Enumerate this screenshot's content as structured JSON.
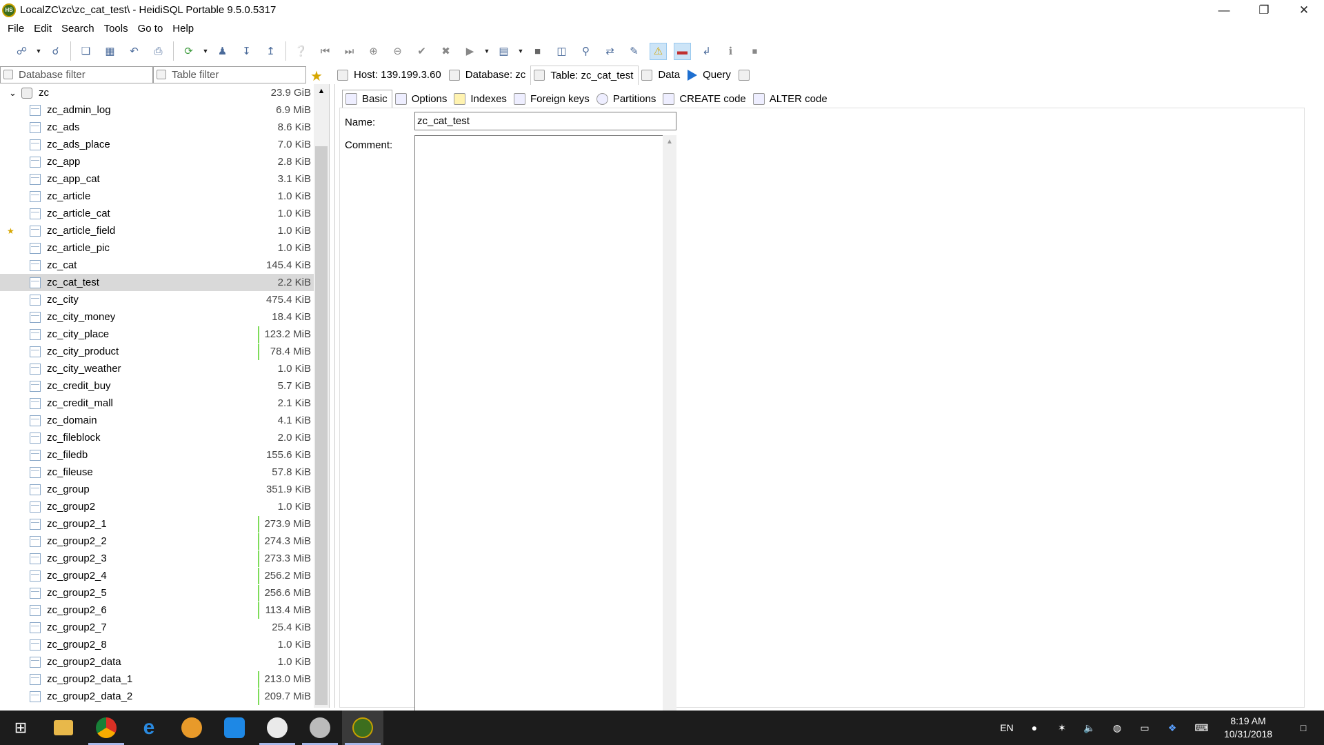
{
  "window": {
    "title": "LocalZC\\zc\\zc_cat_test\\ - HeidiSQL Portable 9.5.0.5317",
    "app_icon_text": "HS"
  },
  "menu": [
    "File",
    "Edit",
    "Search",
    "Tools",
    "Go to",
    "Help"
  ],
  "filters": {
    "database_placeholder": "Database filter",
    "table_placeholder": "Table filter"
  },
  "tree": {
    "database": {
      "name": "zc",
      "size": "23.9 GiB"
    },
    "tables": [
      {
        "name": "zc_admin_log",
        "size": "6.9 MiB"
      },
      {
        "name": "zc_ads",
        "size": "8.6 KiB"
      },
      {
        "name": "zc_ads_place",
        "size": "7.0 KiB"
      },
      {
        "name": "zc_app",
        "size": "2.8 KiB"
      },
      {
        "name": "zc_app_cat",
        "size": "3.1 KiB"
      },
      {
        "name": "zc_article",
        "size": "1.0 KiB"
      },
      {
        "name": "zc_article_cat",
        "size": "1.0 KiB"
      },
      {
        "name": "zc_article_field",
        "size": "1.0 KiB",
        "favorite": true
      },
      {
        "name": "zc_article_pic",
        "size": "1.0 KiB"
      },
      {
        "name": "zc_cat",
        "size": "145.4 KiB"
      },
      {
        "name": "zc_cat_test",
        "size": "2.2 KiB",
        "selected": true
      },
      {
        "name": "zc_city",
        "size": "475.4 KiB"
      },
      {
        "name": "zc_city_money",
        "size": "18.4 KiB"
      },
      {
        "name": "zc_city_place",
        "size": "123.2 MiB",
        "bar": true
      },
      {
        "name": "zc_city_product",
        "size": "78.4 MiB",
        "bar": true
      },
      {
        "name": "zc_city_weather",
        "size": "1.0 KiB"
      },
      {
        "name": "zc_credit_buy",
        "size": "5.7 KiB"
      },
      {
        "name": "zc_credit_mall",
        "size": "2.1 KiB"
      },
      {
        "name": "zc_domain",
        "size": "4.1 KiB"
      },
      {
        "name": "zc_fileblock",
        "size": "2.0 KiB"
      },
      {
        "name": "zc_filedb",
        "size": "155.6 KiB"
      },
      {
        "name": "zc_fileuse",
        "size": "57.8 KiB"
      },
      {
        "name": "zc_group",
        "size": "351.9 KiB"
      },
      {
        "name": "zc_group2",
        "size": "1.0 KiB"
      },
      {
        "name": "zc_group2_1",
        "size": "273.9 MiB",
        "bar": true
      },
      {
        "name": "zc_group2_2",
        "size": "274.3 MiB",
        "bar": true
      },
      {
        "name": "zc_group2_3",
        "size": "273.3 MiB",
        "bar": true
      },
      {
        "name": "zc_group2_4",
        "size": "256.2 MiB",
        "bar": true
      },
      {
        "name": "zc_group2_5",
        "size": "256.6 MiB",
        "bar": true
      },
      {
        "name": "zc_group2_6",
        "size": "113.4 MiB",
        "bar": true
      },
      {
        "name": "zc_group2_7",
        "size": "25.4 KiB"
      },
      {
        "name": "zc_group2_8",
        "size": "1.0 KiB"
      },
      {
        "name": "zc_group2_data",
        "size": "1.0 KiB"
      },
      {
        "name": "zc_group2_data_1",
        "size": "213.0 MiB",
        "bar": true
      },
      {
        "name": "zc_group2_data_2",
        "size": "209.7 MiB",
        "bar": true
      }
    ]
  },
  "tabs": {
    "host": "Host: 139.199.3.60",
    "database": "Database: zc",
    "table": "Table: zc_cat_test",
    "data": "Data",
    "query": "Query"
  },
  "subtabs": {
    "basic": "Basic",
    "options": "Options",
    "indexes": "Indexes",
    "foreign_keys": "Foreign keys",
    "partitions": "Partitions",
    "create_code": "CREATE code",
    "alter_code": "ALTER code"
  },
  "form": {
    "name_label": "Name:",
    "name_value": "zc_cat_test",
    "comment_label": "Comment:",
    "comment_value": ""
  },
  "taskbar": {
    "language": "EN",
    "time": "8:19 AM",
    "date": "10/31/2018"
  },
  "colors": {
    "selection": "#d9d9d9",
    "size_bar": "#7edc5a",
    "taskbar": "#1c1c1c",
    "accent_blue": "#1e6fd0"
  }
}
